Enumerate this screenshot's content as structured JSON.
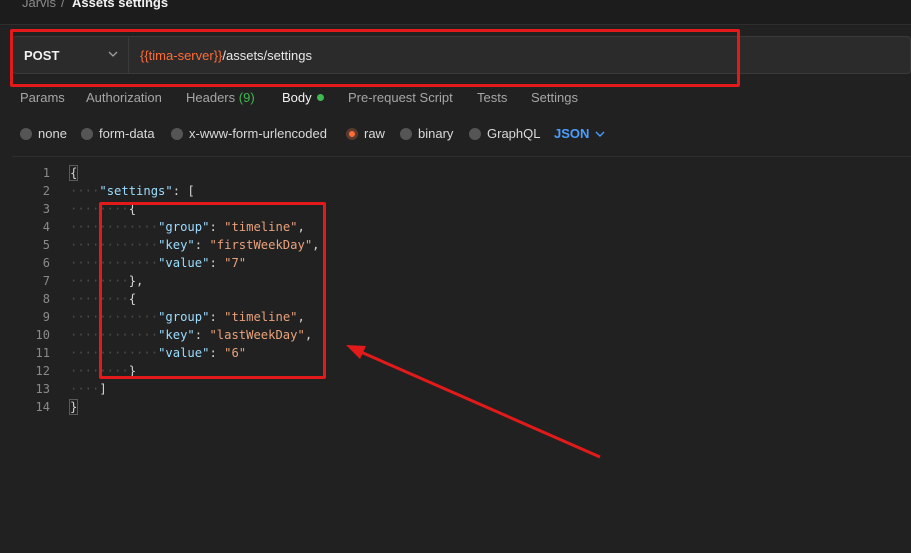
{
  "breadcrumb": {
    "parent": "Jarvis",
    "separator": "/",
    "current": "Assets settings"
  },
  "request": {
    "method": "POST",
    "url_variable": "{{tima-server}}",
    "url_path": "/assets/settings"
  },
  "tabs": [
    {
      "label": "Params"
    },
    {
      "label": "Authorization"
    },
    {
      "label": "Headers",
      "count": "(9)"
    },
    {
      "label": "Body"
    },
    {
      "label": "Pre-request Script"
    },
    {
      "label": "Tests"
    },
    {
      "label": "Settings"
    }
  ],
  "body_types": [
    {
      "label": "none",
      "selected": false
    },
    {
      "label": "form-data",
      "selected": false
    },
    {
      "label": "x-www-form-urlencoded",
      "selected": false
    },
    {
      "label": "raw",
      "selected": true
    },
    {
      "label": "binary",
      "selected": false
    },
    {
      "label": "GraphQL",
      "selected": false
    }
  ],
  "format": "JSON",
  "editor": {
    "line_numbers": [
      "1",
      "2",
      "3",
      "4",
      "5",
      "6",
      "7",
      "8",
      "9",
      "10",
      "11",
      "12",
      "13",
      "14"
    ],
    "tokens": {
      "open_brace": "{",
      "close_brace": "}",
      "open_bracket": "[",
      "close_bracket": "]",
      "settings_key": "\"settings\"",
      "group_key": "\"group\"",
      "key_key": "\"key\"",
      "value_key": "\"value\"",
      "group_val_1": "\"timeline\"",
      "key_val_1": "\"firstWeekDay\"",
      "value_val_1": "\"7\"",
      "group_val_2": "\"timeline\"",
      "key_val_2": "\"lastWeekDay\"",
      "value_val_2": "\"6\""
    }
  },
  "colors": {
    "accent": "#ff6c37",
    "annotation": "#e21a1a",
    "json_key": "#9cdcfe",
    "json_string": "#e9a27c",
    "link": "#4a9eff",
    "success": "#3fb950"
  }
}
